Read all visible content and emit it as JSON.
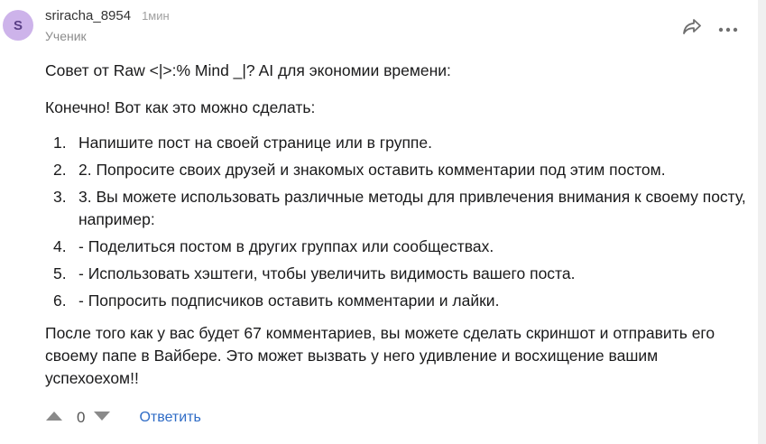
{
  "comment": {
    "avatar_letter": "S",
    "username": "sriracha_8954",
    "time": "1мин",
    "rank": "Ученик",
    "icons": {
      "share": "share-icon",
      "more": "more-dots-icon",
      "upvote": "upvote-triangle-icon",
      "downvote": "downvote-triangle-icon"
    },
    "body": {
      "intro": "Совет от Raw <|>:% Mind _|? AI для экономии времени:",
      "sure": "Конечно! Вот как это можно сделать:",
      "steps": [
        {
          "num": "1.",
          "text": "Напишите пост на своей странице или в группе."
        },
        {
          "num": "2.",
          "text": "2. Попросите своих друзей и знакомых оставить комментарии под этим постом."
        },
        {
          "num": "3.",
          "text": "3. Вы можете использовать различные методы для привлечения внимания к своему посту, например:"
        },
        {
          "num": "4.",
          "text": "- Поделиться постом в других группах или сообществах."
        },
        {
          "num": "5.",
          "text": "- Использовать хэштеги, чтобы увеличить видимость вашего поста."
        },
        {
          "num": "6.",
          "text": "- Попросить подписчиков оставить комментарии и лайки."
        }
      ],
      "outro": "После того как у вас будет 67 комментариев, вы можете сделать скриншот и отправить его своему папе в Вайбере. Это может вызвать у него удивление и восхищение вашим успехоехом!!"
    },
    "score": "0",
    "reply_label": "Ответить"
  },
  "colors": {
    "avatar_bg": "#cdb3ea",
    "link": "#2f6cc6",
    "muted": "#a0a0a0"
  }
}
